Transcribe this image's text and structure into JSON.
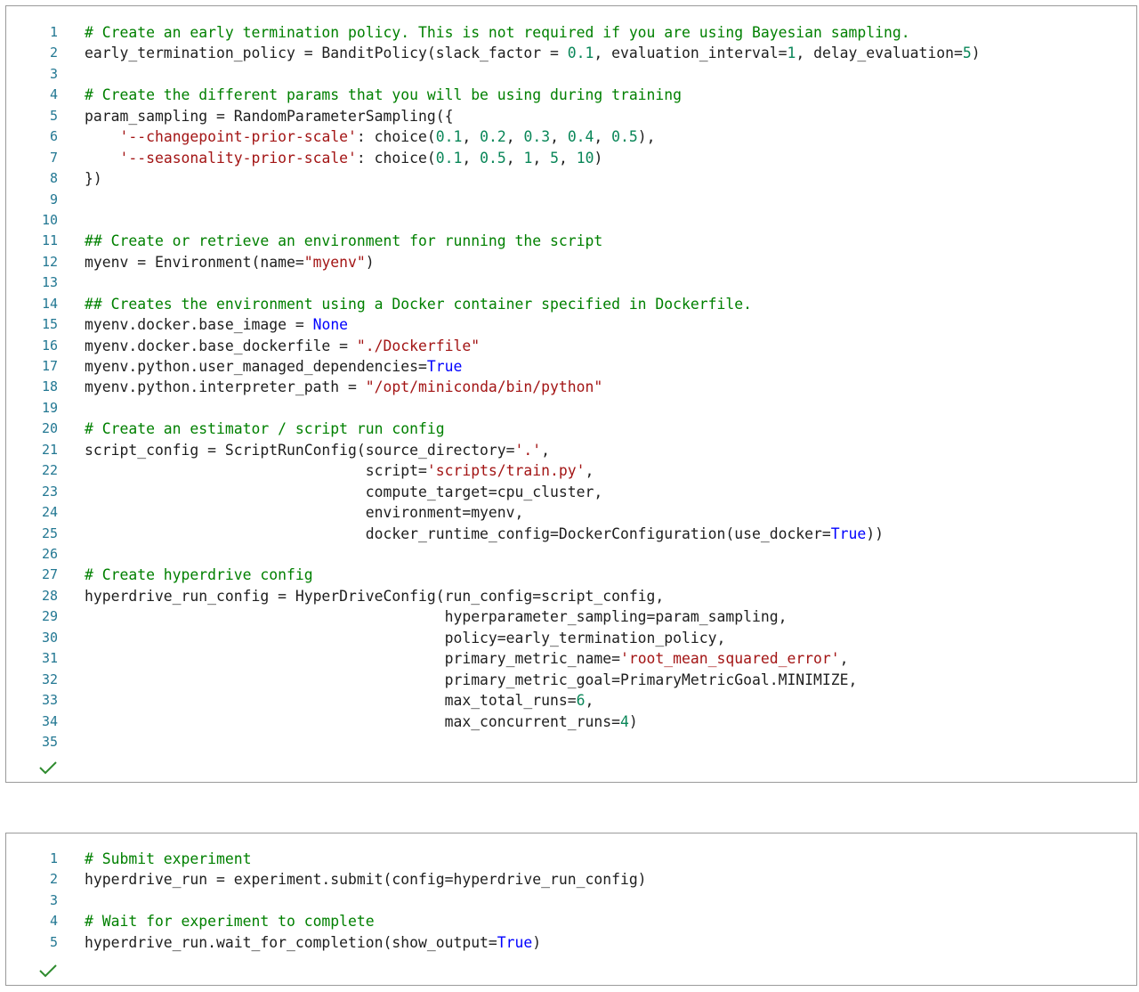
{
  "cells": [
    {
      "status_icon": "checkmark-icon",
      "lines": [
        [
          [
            "c",
            "# Create an early termination policy. This is not required if you are using Bayesian sampling."
          ]
        ],
        [
          [
            "p",
            "early_termination_policy = BanditPolicy(slack_factor = "
          ],
          [
            "n",
            "0.1"
          ],
          [
            "p",
            ", evaluation_interval="
          ],
          [
            "n",
            "1"
          ],
          [
            "p",
            ", delay_evaluation="
          ],
          [
            "n",
            "5"
          ],
          [
            "p",
            ")"
          ]
        ],
        [],
        [
          [
            "c",
            "# Create the different params that you will be using during training"
          ]
        ],
        [
          [
            "p",
            "param_sampling = RandomParameterSampling({"
          ]
        ],
        [
          [
            "p",
            "    "
          ],
          [
            "s",
            "'--changepoint-prior-scale'"
          ],
          [
            "p",
            ": choice("
          ],
          [
            "n",
            "0.1"
          ],
          [
            "p",
            ", "
          ],
          [
            "n",
            "0.2"
          ],
          [
            "p",
            ", "
          ],
          [
            "n",
            "0.3"
          ],
          [
            "p",
            ", "
          ],
          [
            "n",
            "0.4"
          ],
          [
            "p",
            ", "
          ],
          [
            "n",
            "0.5"
          ],
          [
            "p",
            "),"
          ]
        ],
        [
          [
            "p",
            "    "
          ],
          [
            "s",
            "'--seasonality-prior-scale'"
          ],
          [
            "p",
            ": choice("
          ],
          [
            "n",
            "0.1"
          ],
          [
            "p",
            ", "
          ],
          [
            "n",
            "0.5"
          ],
          [
            "p",
            ", "
          ],
          [
            "n",
            "1"
          ],
          [
            "p",
            ", "
          ],
          [
            "n",
            "5"
          ],
          [
            "p",
            ", "
          ],
          [
            "n",
            "10"
          ],
          [
            "p",
            ")"
          ]
        ],
        [
          [
            "p",
            "})"
          ]
        ],
        [],
        [],
        [
          [
            "c",
            "## Create or retrieve an environment for running the script"
          ]
        ],
        [
          [
            "p",
            "myenv = Environment(name="
          ],
          [
            "s",
            "\"myenv\""
          ],
          [
            "p",
            ")"
          ]
        ],
        [],
        [
          [
            "c",
            "## Creates the environment using a Docker container specified in Dockerfile."
          ]
        ],
        [
          [
            "p",
            "myenv.docker.base_image = "
          ],
          [
            "k",
            "None"
          ]
        ],
        [
          [
            "p",
            "myenv.docker.base_dockerfile = "
          ],
          [
            "s",
            "\"./Dockerfile\""
          ]
        ],
        [
          [
            "p",
            "myenv.python.user_managed_dependencies="
          ],
          [
            "k",
            "True"
          ]
        ],
        [
          [
            "p",
            "myenv.python.interpreter_path = "
          ],
          [
            "s",
            "\"/opt/miniconda/bin/python\""
          ]
        ],
        [],
        [
          [
            "c",
            "# Create an estimator / script run config"
          ]
        ],
        [
          [
            "p",
            "script_config = ScriptRunConfig(source_directory="
          ],
          [
            "s",
            "'.'"
          ],
          [
            "p",
            ","
          ]
        ],
        [
          [
            "p",
            "                                script="
          ],
          [
            "s",
            "'scripts/train.py'"
          ],
          [
            "p",
            ","
          ]
        ],
        [
          [
            "p",
            "                                compute_target=cpu_cluster,"
          ]
        ],
        [
          [
            "p",
            "                                environment=myenv,"
          ]
        ],
        [
          [
            "p",
            "                                docker_runtime_config=DockerConfiguration(use_docker="
          ],
          [
            "k",
            "True"
          ],
          [
            "p",
            "))"
          ]
        ],
        [],
        [
          [
            "c",
            "# Create hyperdrive config"
          ]
        ],
        [
          [
            "p",
            "hyperdrive_run_config = HyperDriveConfig(run_config=script_config,"
          ]
        ],
        [
          [
            "p",
            "                                         hyperparameter_sampling=param_sampling,"
          ]
        ],
        [
          [
            "p",
            "                                         policy=early_termination_policy,"
          ]
        ],
        [
          [
            "p",
            "                                         primary_metric_name="
          ],
          [
            "s",
            "'root_mean_squared_error'"
          ],
          [
            "p",
            ","
          ]
        ],
        [
          [
            "p",
            "                                         primary_metric_goal=PrimaryMetricGoal.MINIMIZE,"
          ]
        ],
        [
          [
            "p",
            "                                         max_total_runs="
          ],
          [
            "n",
            "6"
          ],
          [
            "p",
            ","
          ]
        ],
        [
          [
            "p",
            "                                         max_concurrent_runs="
          ],
          [
            "n",
            "4"
          ],
          [
            "p",
            ")"
          ]
        ],
        []
      ]
    },
    {
      "status_icon": "checkmark-icon",
      "lines": [
        [
          [
            "c",
            "# Submit experiment"
          ]
        ],
        [
          [
            "p",
            "hyperdrive_run = experiment.submit(config=hyperdrive_run_config)"
          ]
        ],
        [],
        [
          [
            "c",
            "# Wait for experiment to complete"
          ]
        ],
        [
          [
            "p",
            "hyperdrive_run.wait_for_completion(show_output="
          ],
          [
            "k",
            "True"
          ],
          [
            "p",
            ")"
          ]
        ]
      ]
    }
  ]
}
